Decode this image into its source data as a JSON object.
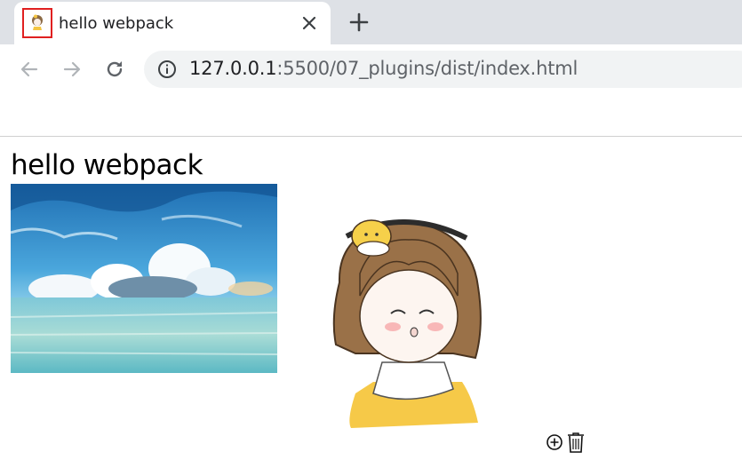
{
  "browser": {
    "tab": {
      "title": "hello webpack",
      "favicon": "girl-favicon-icon"
    },
    "address": {
      "host": "127.0.0.1",
      "path": ":5500/07_plugins/dist/index.html"
    },
    "icons": {
      "tab_close": "close-icon",
      "new_tab": "plus-icon",
      "back": "arrow-left-icon",
      "forward": "arrow-right-icon",
      "reload": "reload-icon",
      "info": "info-icon"
    }
  },
  "page": {
    "heading": "hello webpack",
    "images": [
      "sky-sea-landscape",
      "cartoon-girl-illustration"
    ],
    "action_icons": [
      "zoom-in-icon",
      "trash-icon"
    ]
  },
  "colors": {
    "tabstrip": "#dee1e6",
    "highlight_border": "#e02020",
    "omnibox": "#f1f3f4"
  }
}
